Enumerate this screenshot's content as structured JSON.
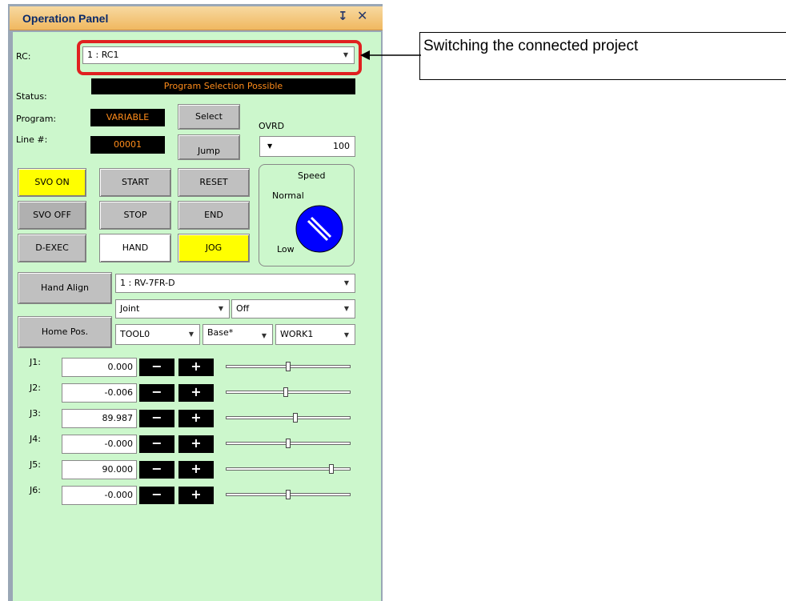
{
  "panel": {
    "title": "Operation Panel",
    "pin_glyph": "Ⅲ",
    "close_glyph": "✕"
  },
  "rc": {
    "label": "RC:",
    "value": "1 : RC1"
  },
  "status": {
    "label": "Status:",
    "value": "Program Selection Possible"
  },
  "program": {
    "label": "Program:",
    "value": "VARIABLE"
  },
  "line": {
    "label": "Line #:",
    "value": "00001"
  },
  "buttons": {
    "select": "Select",
    "jump": "Jump",
    "svo_on": "SVO ON",
    "svo_off": "SVO OFF",
    "d_exec": "D-EXEC",
    "start": "START",
    "stop": "STOP",
    "hand": "HAND",
    "reset": "RESET",
    "end": "END",
    "jog": "JOG",
    "hand_align": "Hand Align",
    "home_pos": "Home Pos."
  },
  "ovrd": {
    "label": "OVRD",
    "value": "100"
  },
  "speed": {
    "title": "Speed",
    "normal": "Normal",
    "low": "Low"
  },
  "robot": {
    "value": "1 : RV-7FR-D"
  },
  "jog_mode": {
    "value": "Joint"
  },
  "jog_option": {
    "value": "Off"
  },
  "tool": {
    "value": "TOOL0"
  },
  "base": {
    "value": "Base*"
  },
  "work": {
    "value": "WORK1"
  },
  "joints": [
    {
      "label": "J1:",
      "value": "0.000",
      "slider_fraction": 0.5
    },
    {
      "label": "J2:",
      "value": "-0.006",
      "slider_fraction": 0.48
    },
    {
      "label": "J3:",
      "value": "89.987",
      "slider_fraction": 0.56
    },
    {
      "label": "J4:",
      "value": "-0.000",
      "slider_fraction": 0.5
    },
    {
      "label": "J5:",
      "value": "90.000",
      "slider_fraction": 0.86
    },
    {
      "label": "J6:",
      "value": "-0.000",
      "slider_fraction": 0.5
    }
  ],
  "pm": {
    "minus": "−",
    "plus": "+"
  },
  "callout": {
    "text": "Switching the connected project"
  },
  "colors": {
    "panel_bg": "#ccf7cc",
    "highlight": "#e02020",
    "knob": "#0000ff",
    "status_text": "#ff8c1a"
  }
}
